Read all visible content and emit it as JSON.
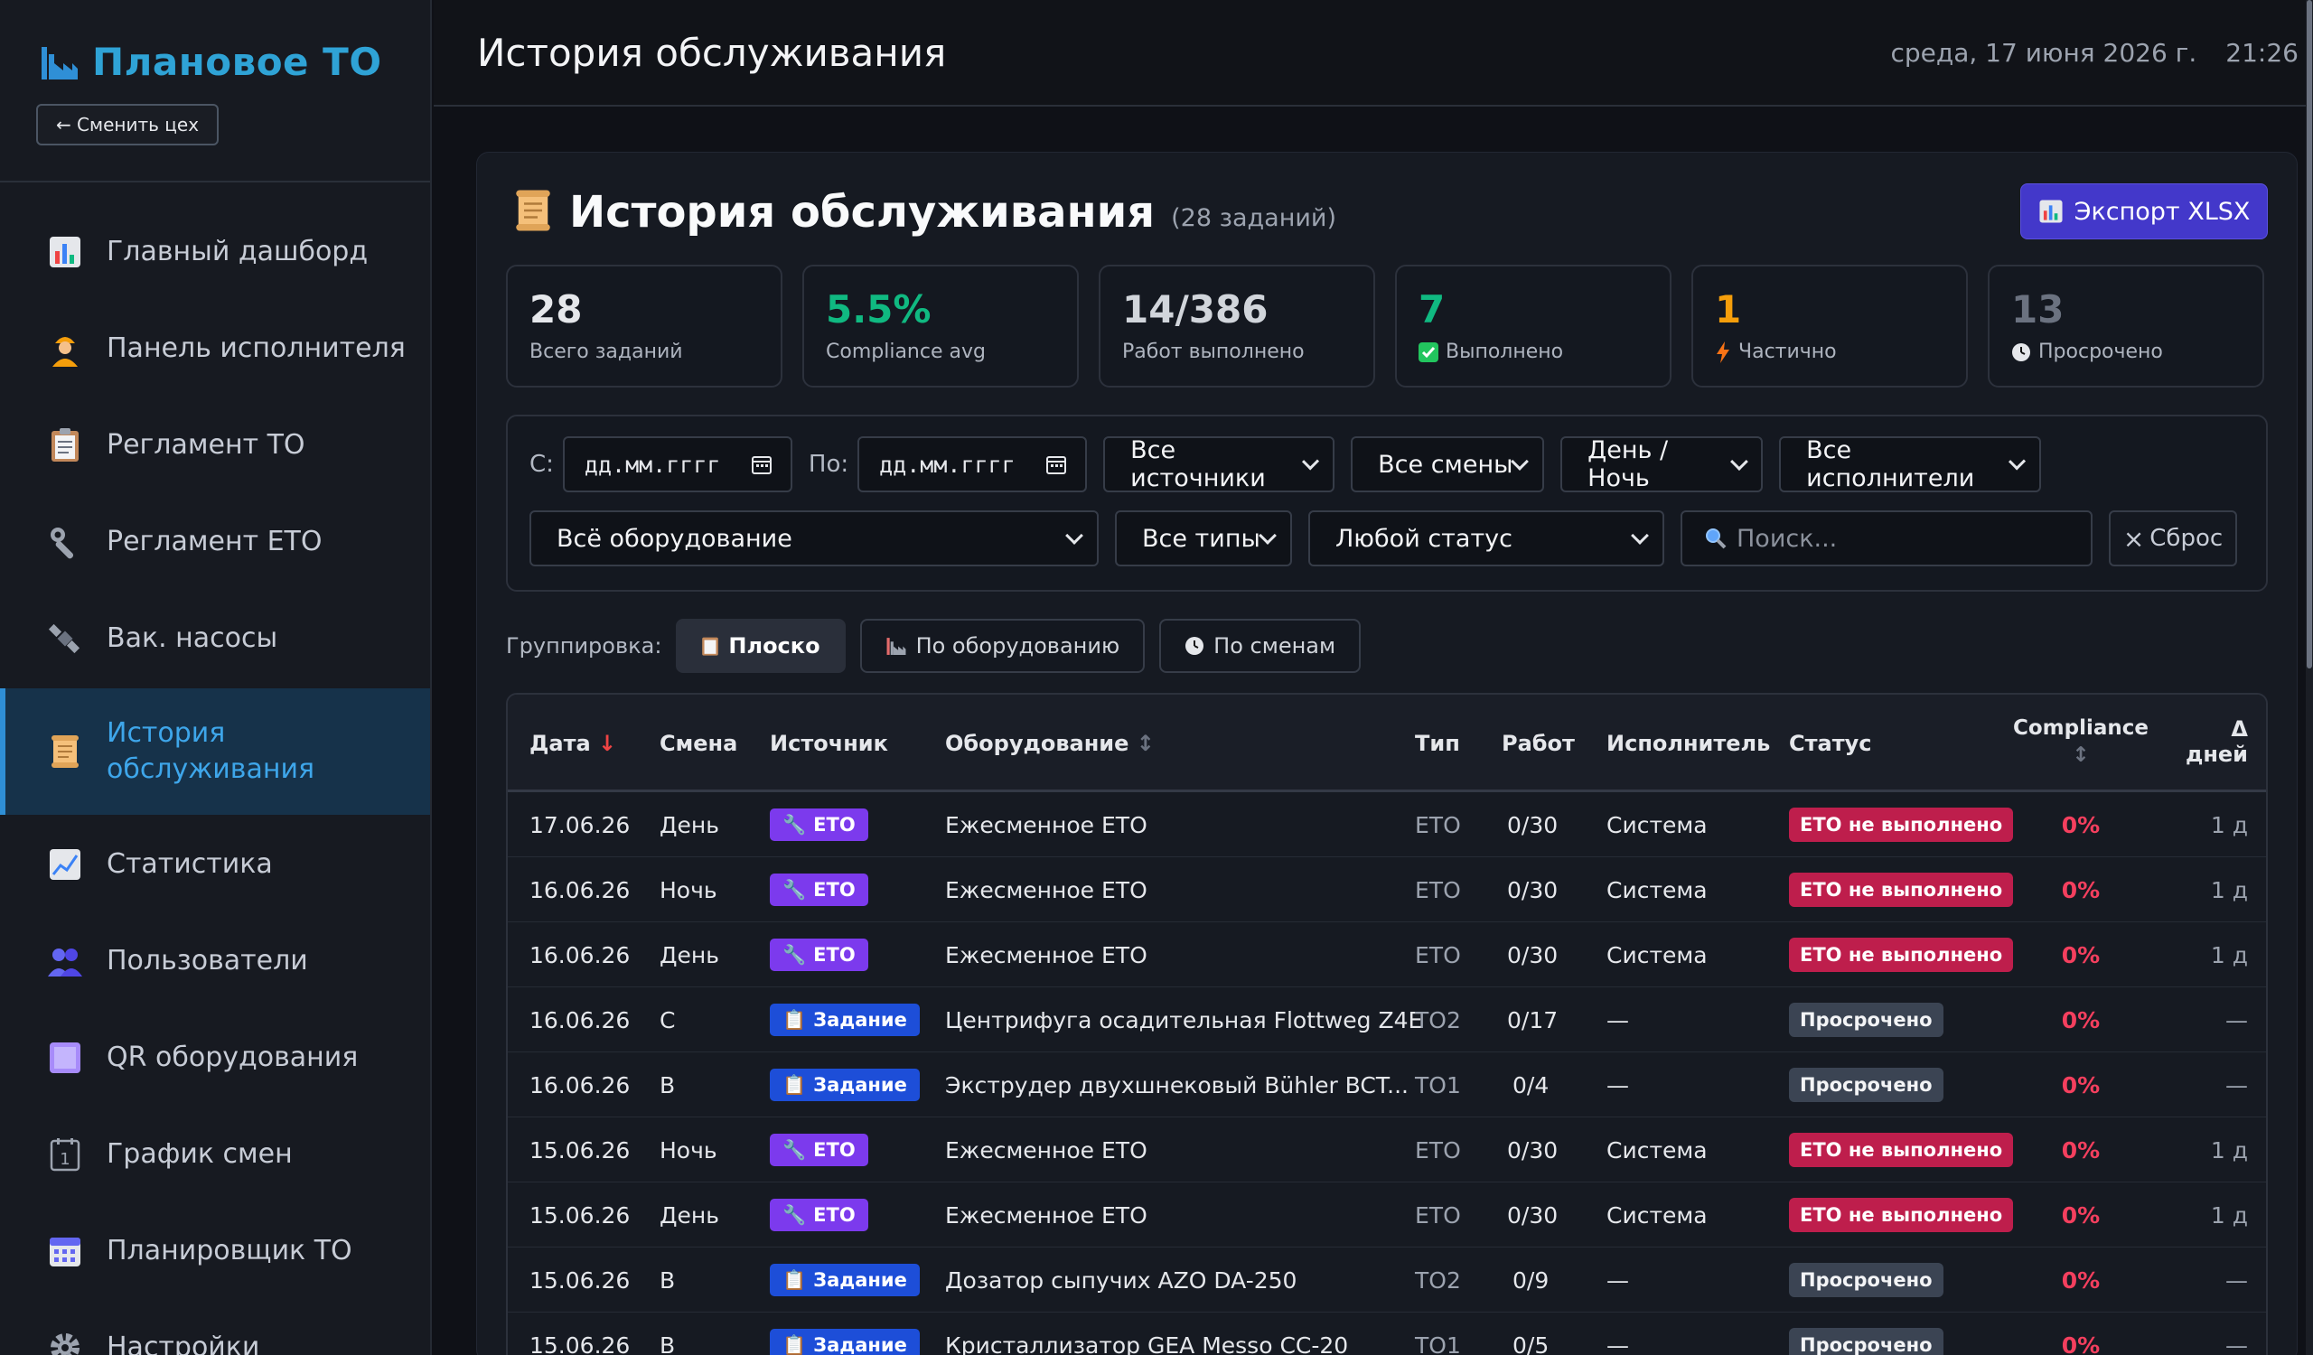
{
  "sidebar": {
    "brand": "Плановое ТО",
    "change_button": "← Сменить цех",
    "items": [
      {
        "label": "Главный дашборд",
        "icon": "bar-chart-icon"
      },
      {
        "label": "Панель исполнителя",
        "icon": "worker-icon"
      },
      {
        "label": "Регламент ТО",
        "icon": "clipboard-icon"
      },
      {
        "label": "Регламент ЕТО",
        "icon": "wrench-icon"
      },
      {
        "label": "Вак. насосы",
        "icon": "satellite-icon"
      },
      {
        "label": "История обслуживания",
        "icon": "scroll-icon"
      },
      {
        "label": "Статистика",
        "icon": "chart-up-icon"
      },
      {
        "label": "Пользователи",
        "icon": "users-icon"
      },
      {
        "label": "QR оборудования",
        "icon": "qr-icon"
      },
      {
        "label": "График смен",
        "icon": "calendar-1-icon"
      },
      {
        "label": "Планировщик ТО",
        "icon": "calendar-icon"
      },
      {
        "label": "Настройки",
        "icon": "gear-icon"
      }
    ]
  },
  "header": {
    "title": "История обслуживания",
    "date": "среда, 17 июня 2026 г.",
    "time": "21:26"
  },
  "card": {
    "title": "История обслуживания",
    "count": "(28 заданий)",
    "export_label": "Экспорт XLSX"
  },
  "stats": [
    {
      "value": "28",
      "label": "Всего заданий",
      "color": "#e5e7eb",
      "icon": ""
    },
    {
      "value": "5.5%",
      "label": "Compliance avg",
      "color": "#10b981",
      "icon": ""
    },
    {
      "value": "14/386",
      "label": "Работ выполнено",
      "color": "#e5e7eb",
      "icon": ""
    },
    {
      "value": "7",
      "label": "Выполнено",
      "color": "#10b981",
      "icon": "check-icon"
    },
    {
      "value": "1",
      "label": "Частично",
      "color": "#f59e0b",
      "icon": "lightning-icon"
    },
    {
      "value": "13",
      "label": "Просрочено",
      "color": "#6b7280",
      "icon": "clock-icon"
    }
  ],
  "filters": {
    "from_label": "С:",
    "from_placeholder": "дд.мм.гггг",
    "to_label": "По:",
    "to_placeholder": "дд.мм.гггг",
    "sources": "Все источники",
    "shifts": "Все смены",
    "daynight": "День / Ночь",
    "executors": "Все исполнители",
    "equipment": "Всё оборудование",
    "types": "Все типы",
    "status": "Любой статус",
    "search_placeholder": "Поиск...",
    "reset": "Сброс"
  },
  "grouping": {
    "label": "Группировка:",
    "options": [
      "Плоско",
      "По оборудованию",
      "По сменам"
    ]
  },
  "table": {
    "headers": {
      "date": "Дата",
      "date_sort": "↓",
      "shift": "Смена",
      "source": "Источник",
      "equipment": "Оборудование",
      "equipment_sort": "↕",
      "type": "Тип",
      "works": "Работ",
      "executor": "Исполнитель",
      "status": "Статус",
      "compliance": "Compliance",
      "compliance_sort": "↕",
      "delta_1": "Δ",
      "delta_2": "дней"
    },
    "rows": [
      {
        "date": "17.06.26",
        "shift": "День",
        "source": "ЕТО",
        "equipment": "Ежесменное ЕТО",
        "type": "ЕТО",
        "works": "0/30",
        "executor": "Система",
        "status": "ЕТО не выполнено",
        "compliance": "0%",
        "delta": "1 д"
      },
      {
        "date": "16.06.26",
        "shift": "Ночь",
        "source": "ЕТО",
        "equipment": "Ежесменное ЕТО",
        "type": "ЕТО",
        "works": "0/30",
        "executor": "Система",
        "status": "ЕТО не выполнено",
        "compliance": "0%",
        "delta": "1 д"
      },
      {
        "date": "16.06.26",
        "shift": "День",
        "source": "ЕТО",
        "equipment": "Ежесменное ЕТО",
        "type": "ЕТО",
        "works": "0/30",
        "executor": "Система",
        "status": "ЕТО не выполнено",
        "compliance": "0%",
        "delta": "1 д"
      },
      {
        "date": "16.06.26",
        "shift": "С",
        "source": "Задание",
        "equipment": "Центрифуга осадительная Flottweg Z4E",
        "type": "ТО2",
        "works": "0/17",
        "executor": "—",
        "status": "Просрочено",
        "compliance": "0%",
        "delta": "—"
      },
      {
        "date": "16.06.26",
        "shift": "В",
        "source": "Задание",
        "equipment": "Экструдер двухшнековый Bühler BCT...",
        "type": "ТО1",
        "works": "0/4",
        "executor": "—",
        "status": "Просрочено",
        "compliance": "0%",
        "delta": "—"
      },
      {
        "date": "15.06.26",
        "shift": "Ночь",
        "source": "ЕТО",
        "equipment": "Ежесменное ЕТО",
        "type": "ЕТО",
        "works": "0/30",
        "executor": "Система",
        "status": "ЕТО не выполнено",
        "compliance": "0%",
        "delta": "1 д"
      },
      {
        "date": "15.06.26",
        "shift": "День",
        "source": "ЕТО",
        "equipment": "Ежесменное ЕТО",
        "type": "ЕТО",
        "works": "0/30",
        "executor": "Система",
        "status": "ЕТО не выполнено",
        "compliance": "0%",
        "delta": "1 д"
      },
      {
        "date": "15.06.26",
        "shift": "В",
        "source": "Задание",
        "equipment": "Дозатор сыпучих AZO DA-250",
        "type": "ТО2",
        "works": "0/9",
        "executor": "—",
        "status": "Просрочено",
        "compliance": "0%",
        "delta": "—"
      },
      {
        "date": "15.06.26",
        "shift": "В",
        "source": "Задание",
        "equipment": "Кристаллизатор GEA Messo CC-20",
        "type": "ТО1",
        "works": "0/5",
        "executor": "—",
        "status": "Просрочено",
        "compliance": "0%",
        "delta": "—"
      }
    ]
  }
}
